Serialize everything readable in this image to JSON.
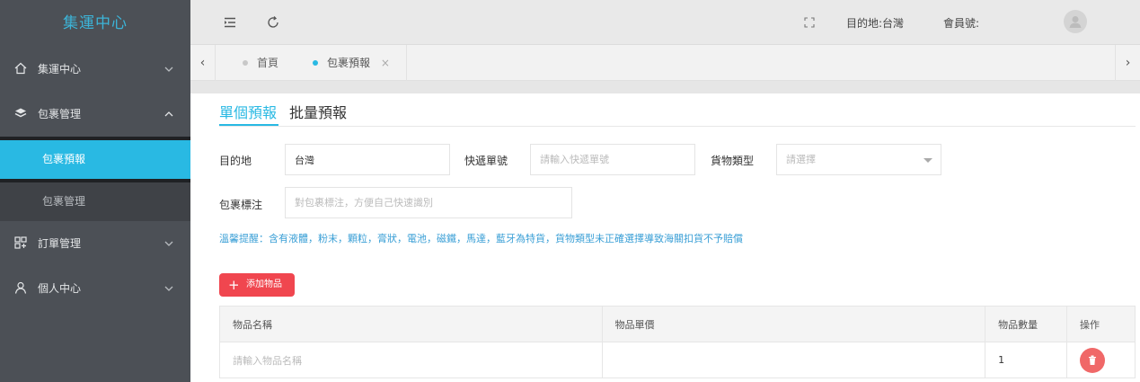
{
  "sidebar": {
    "logo": "集運中心",
    "items": [
      {
        "label": "集運中心",
        "icon": "home-icon",
        "expanded": false
      },
      {
        "label": "包裹管理",
        "icon": "layers-icon",
        "expanded": true
      },
      {
        "label": "訂單管理",
        "icon": "grid-icon",
        "expanded": false
      },
      {
        "label": "個人中心",
        "icon": "user-icon",
        "expanded": false
      }
    ],
    "subitems": [
      {
        "label": "包裹預報",
        "active": true
      },
      {
        "label": "包裹管理",
        "active": false
      }
    ]
  },
  "header": {
    "destination": "目的地:台灣",
    "member": "會員號:"
  },
  "tabs": {
    "home": "首頁",
    "current": "包裹預報",
    "close": "×"
  },
  "form": {
    "tab_single": "單個預報",
    "tab_batch": "批量預報",
    "destination_label": "目的地",
    "destination_value": "台灣",
    "tracking_label": "快遞單號",
    "tracking_placeholder": "請輸入快遞單號",
    "goods_type_label": "貨物類型",
    "goods_type_placeholder": "請選擇",
    "remark_label": "包裹標注",
    "remark_placeholder": "對包裹標注，方便自己快速識別",
    "warning": "溫馨提醒：含有液體，粉末，顆粒，膏狀，電池，磁鐵，馬達，藍牙為特貨，貨物類型未正確選擇導致海關扣貨不予賠償",
    "add_item": "添加物品"
  },
  "table": {
    "headers": [
      "物品名稱",
      "物品單價",
      "物品數量",
      "操作"
    ],
    "rows": [
      {
        "name_placeholder": "請輸入物品名稱",
        "price": "",
        "quantity": "1"
      }
    ]
  },
  "colors": {
    "accent": "#29b9e3",
    "sidebar_bg": "#4c5056",
    "danger": "#f0464f"
  }
}
